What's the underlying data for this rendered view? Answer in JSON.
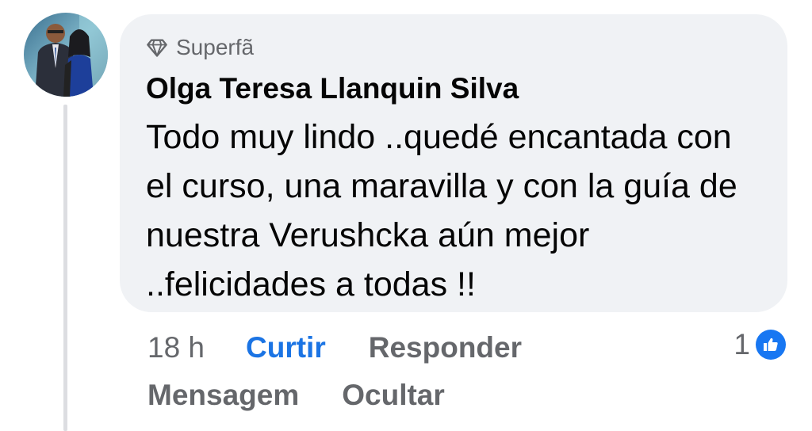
{
  "comment": {
    "badge_label": "Superfã",
    "badge_icon": "diamond-icon",
    "author_name": "Olga Teresa Llanquin Silva",
    "text": "Todo muy lindo ..quedé encantada con el curso, una maravilla y con la guía de nuestra Verushcka aún mejor ..felicidades a todas !!",
    "timestamp": "18 h",
    "reaction_count": "1",
    "reaction_icon": "like-icon"
  },
  "actions": {
    "like_label": "Curtir",
    "reply_label": "Responder",
    "message_label": "Mensagem",
    "hide_label": "Ocultar"
  },
  "colors": {
    "bubble_bg": "#f0f2f5",
    "secondary_text": "#65676b",
    "primary_text": "#050505",
    "accent": "#1b74e4",
    "like_blue": "#1877f2"
  }
}
